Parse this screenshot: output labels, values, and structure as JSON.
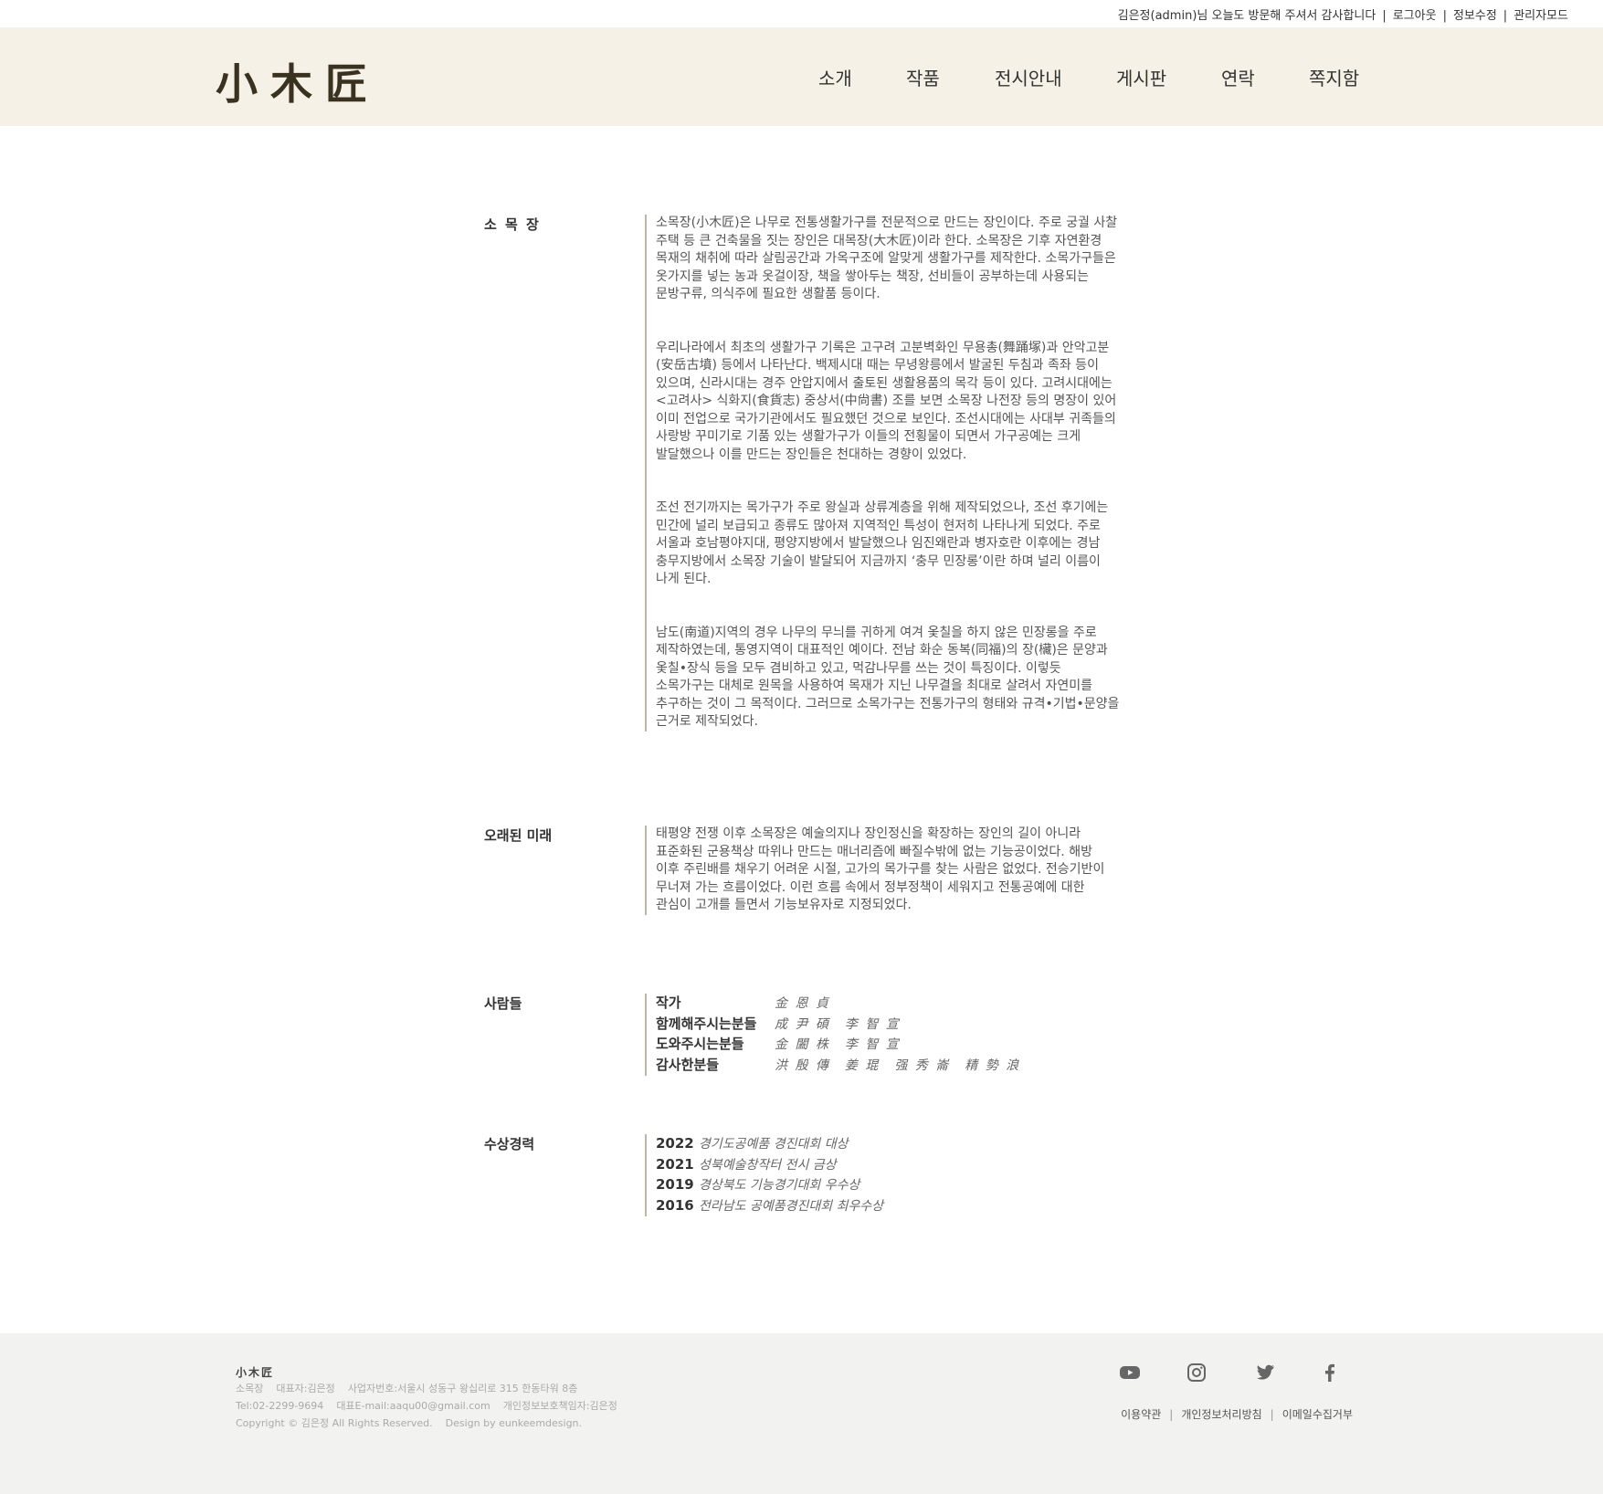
{
  "topbar": {
    "greeting": "김은정(admin)님 오늘도 방문해 주셔서 감사합니다",
    "logout": "로그아웃",
    "edit_profile": "정보수정",
    "admin_mode": "관리자모드"
  },
  "header": {
    "logo": "小木匠",
    "nav": [
      "소개",
      "작품",
      "전시안내",
      "게시판",
      "연락",
      "쪽지함"
    ]
  },
  "sections": {
    "somokjang": {
      "title": "소 목 장",
      "paragraphs": [
        "소목장(小木匠)은 나무로 전통생활가구를 전문적으로 만드는 장인이다. 주로 궁궐 사찰 주택 등 큰 건축물을 짓는 장인은 대목장(大木匠)이라 한다. 소목장은 기후 자연환경 목재의 채취에 따라 살림공간과 가옥구조에 알맞게 생활가구를 제작한다. 소목가구들은 옷가지를 넣는 농과 옷걸이장, 책을 쌓아두는 책장, 선비들이 공부하는데 사용되는 문방구류, 의식주에 필요한 생활품 등이다.",
        "우리나라에서 최초의 생활가구 기록은 고구려 고분벽화인 무용총(舞踊塚)과 안악고분(安岳古墳) 등에서 나타난다. 백제시대 때는 무녕왕릉에서 발굴된 두침과 족좌 등이 있으며, 신라시대는 경주 안압지에서 출토된 생활용품의 목각 등이 있다. 고려시대에는 <고려사> 식화지(食貨志) 중상서(中尙書) 조를 보면 소목장 나전장 등의 명장이 있어 이미 전업으로 국가기관에서도 필요했던 것으로 보인다. 조선시대에는 사대부 귀족들의 사랑방 꾸미기로 기품 있는 생활가구가 이들의 전횡물이 되면서 가구공예는 크게 발달했으나 이를 만드는 장인들은 천대하는 경향이 있었다.",
        "조선 전기까지는 목가구가 주로 왕실과 상류계층을 위해 제작되었으나, 조선 후기에는 민간에 널리 보급되고 종류도 많아져 지역적인 특성이 현저히 나타나게 되었다. 주로 서울과 호남평야지대, 평양지방에서 발달했으나 임진왜란과 병자호란 이후에는 경남 충무지방에서 소목장 기술이 발달되어 지금까지 ‘충무 민장롱’이란 하며 널리 이름이 나게 된다.",
        "남도(南道)지역의 경우 나무의 무늬를 귀하게 여겨 옻칠을 하지 않은 민장롱을 주로 제작하였는데, 통영지역이 대표적인 예이다. 전남 화순 동복(同福)의 장(欌)은 문양과 옻칠•장식 등을 모두 겸비하고 있고, 먹감나무를 쓰는 것이 특징이다. 이렇듯 소목가구는 대체로 원목을 사용하여 목재가 지닌 나무결을 최대로 살려서 자연미를 추구하는 것이 그 목적이다. 그러므로 소목가구는 전통가구의 형태와 규격•기법•문양을 근거로 제작되었다."
      ]
    },
    "future": {
      "title": "오래된 미래",
      "paragraphs": [
        "태평양 전쟁 이후 소목장은 예술의지나 장인정신을 확장하는 장인의 길이 아니라 표준화된 군용책상 따위나 만드는 매너리즘에 빠질수밖에 없는 기능공이었다. 해방 이후 주린배를 채우기 어려운 시절, 고가의 목가구를 찾는 사람은 없었다. 전승기반이 무너져 가는 흐름이었다. 이런 흐름 속에서 정부정책이 세워지고 전통공예에 대한 관심이 고개를 들면서 기능보유자로 지정되었다."
      ]
    },
    "people": {
      "title": "사람들",
      "rows": [
        {
          "label": "작가",
          "value": "金 恩 貞"
        },
        {
          "label": "함께해주시는분들",
          "value": "成 尹 碩　李 智 宣"
        },
        {
          "label": "도와주시는분들",
          "value": "金 闔 株　李 智 宣"
        },
        {
          "label": "감사한분들",
          "value": "洪 殷 傳　姜 琨　强 秀 崙　精 勢 浪"
        }
      ]
    },
    "awards": {
      "title": "수상경력",
      "rows": [
        {
          "year": "2022",
          "award": "경기도공예품 경진대회 대상"
        },
        {
          "year": "2021",
          "award": "성북예술창작터 전시 금상"
        },
        {
          "year": "2019",
          "award": "경상북도 기능경기대회 우수상"
        },
        {
          "year": "2016",
          "award": "전라남도 공예품경진대회 최우수상"
        }
      ]
    }
  },
  "footer": {
    "logo": "小木匠",
    "line1": [
      "소목장",
      "대표자:김은정",
      "사업자번호:서울시 성동구 왕십리로 315 한동타워 8층"
    ],
    "line2": [
      "Tel:02-2299-9694",
      "대표E-mail:aaqu00@gmail.com",
      "개인정보보호책임자:김은정"
    ],
    "line3": [
      "Copyright © 김은정  All Rights Reserved.",
      "Design by eunkeemdesign."
    ],
    "links": [
      "이용약관",
      "개인정보처리방침",
      "이메일수집거부"
    ]
  },
  "colors": {
    "header_bg": "#f5f1e6",
    "footer_bg": "#f2f2f0",
    "logo": "#3a3220",
    "section_rule": "#bdb6a6",
    "icon": "#666666"
  },
  "icons": [
    "youtube-icon",
    "instagram-icon",
    "twitter-icon",
    "facebook-icon"
  ]
}
